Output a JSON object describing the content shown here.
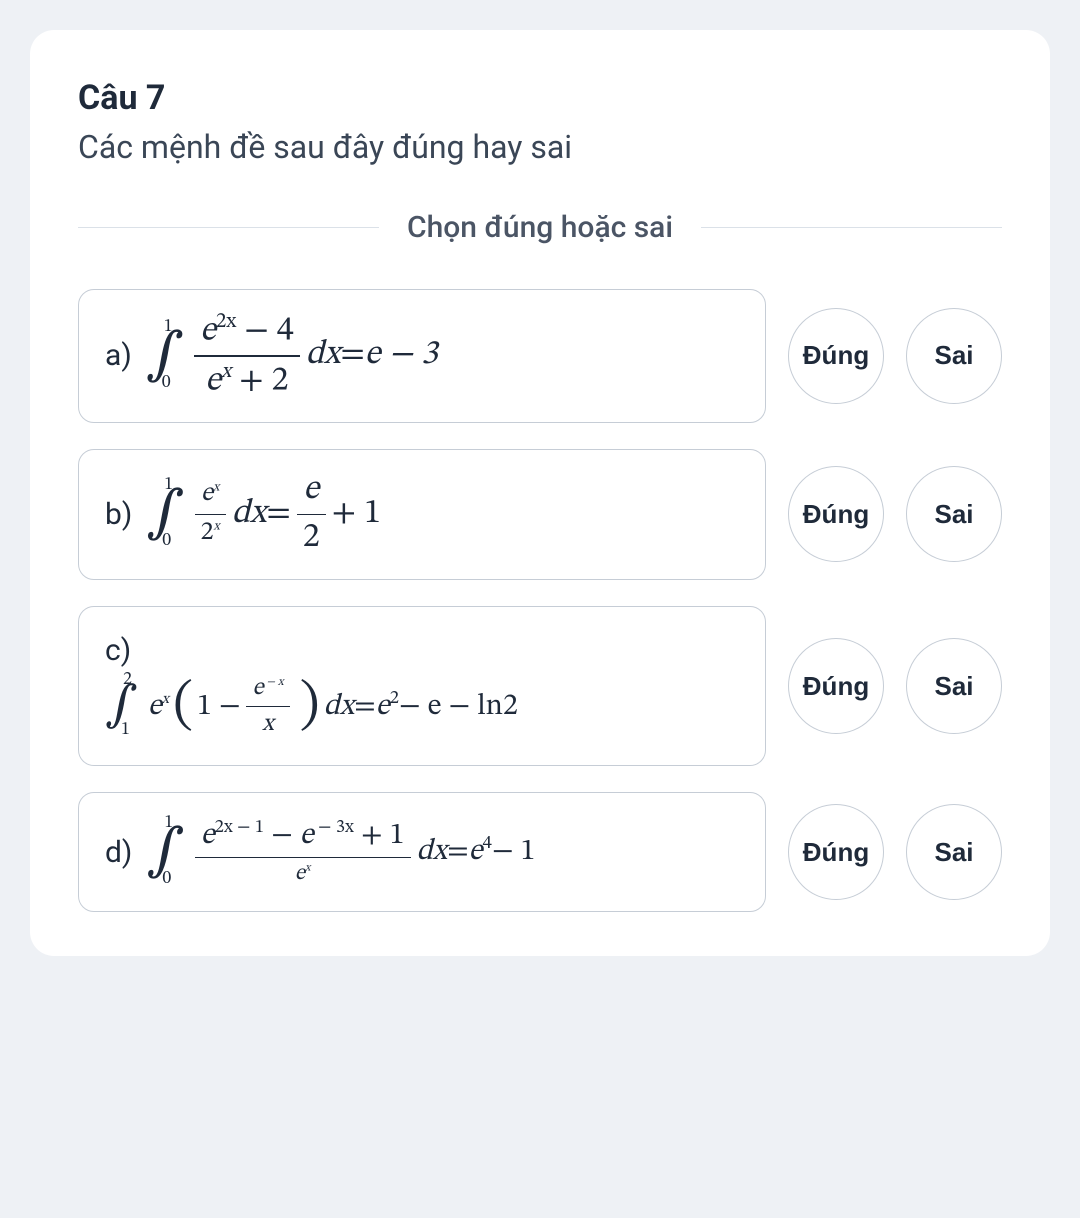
{
  "question": {
    "title": "Câu 7",
    "prompt": "Các mệnh đề sau đây đúng hay sai",
    "instruction": "Chọn đúng hoặc sai"
  },
  "buttons": {
    "true": "Đúng",
    "false": "Sai"
  },
  "items": [
    {
      "label": "a)",
      "formula": {
        "int_lower": "0",
        "int_upper": "1",
        "frac_num_a": "e",
        "frac_num_exp": "2x",
        "frac_num_b": " − 4",
        "frac_den_a": "e",
        "frac_den_exp": "x",
        "frac_den_b": " + 2",
        "dx": "dx",
        "eq": " = ",
        "rhs": "e − 3"
      }
    },
    {
      "label": "b)",
      "formula": {
        "int_lower": "0",
        "int_upper": "1",
        "lfrac_num_a": "e",
        "lfrac_num_exp": "x",
        "lfrac_den_a": "2",
        "lfrac_den_exp": "x",
        "dx": "dx",
        "eq": " = ",
        "rfrac_num": "e",
        "rfrac_den": "2",
        "tail": " + 1"
      }
    },
    {
      "label": "c)",
      "formula": {
        "int_lower": "1",
        "int_upper": "2",
        "lead_a": "e",
        "lead_exp": "x",
        "one": "1 − ",
        "pfrac_num_a": "e",
        "pfrac_num_exp": " − x",
        "pfrac_den": "x",
        "dx": " dx",
        "eq": " = ",
        "rhs_a": "e",
        "rhs_a_exp": "2",
        "rhs_mid": " − e − ln2"
      }
    },
    {
      "label": "d)",
      "formula": {
        "int_lower": "0",
        "int_upper": "1",
        "num_t1_a": "e",
        "num_t1_exp": "2x − 1",
        "num_mid1": " − ",
        "num_t2_a": "e",
        "num_t2_exp": " − 3x",
        "num_tail": " + 1",
        "den_a": "e",
        "den_exp": "x",
        "dx": "dx",
        "eq": " = ",
        "rhs_a": "e",
        "rhs_a_exp": "4",
        "rhs_tail": " − 1"
      }
    }
  ]
}
